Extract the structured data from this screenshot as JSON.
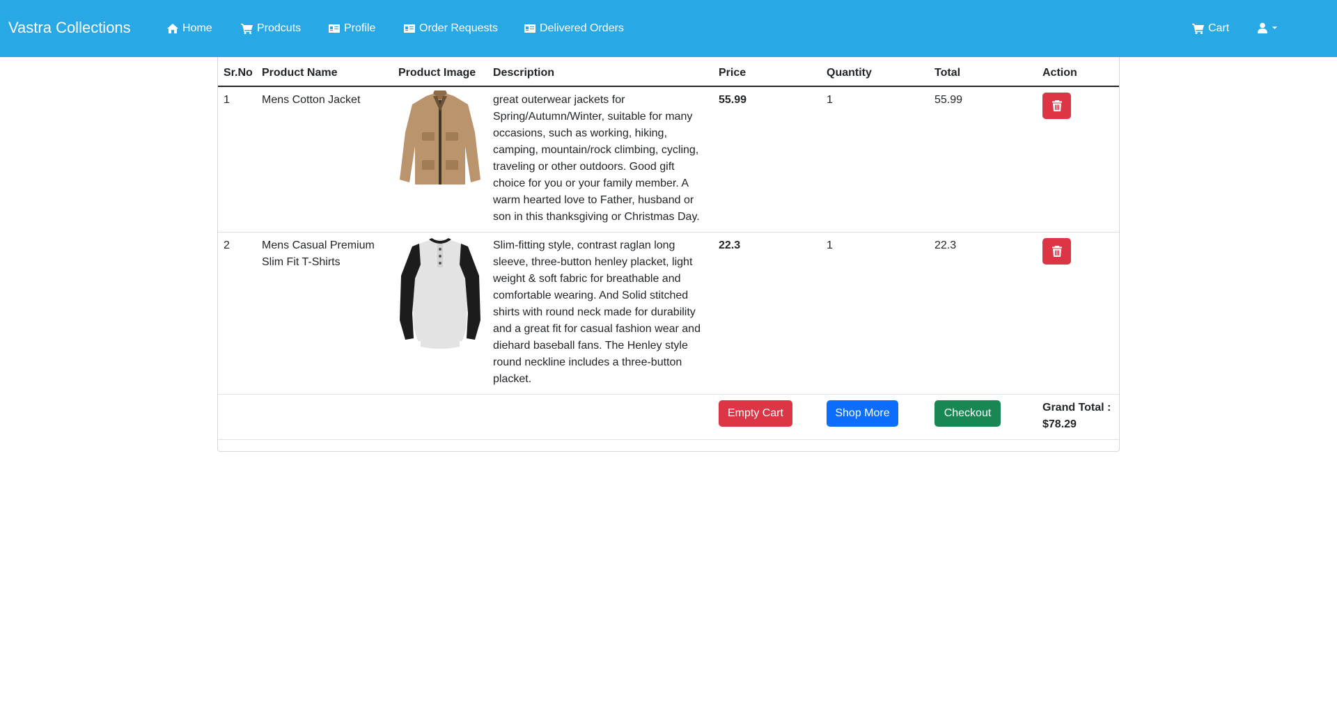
{
  "nav": {
    "brand": "Vastra Collections",
    "items": [
      {
        "label": "Home",
        "icon": "home-icon"
      },
      {
        "label": "Prodcuts",
        "icon": "cart-icon"
      },
      {
        "label": "Profile",
        "icon": "id-card-icon"
      },
      {
        "label": "Order Requests",
        "icon": "id-card-icon"
      },
      {
        "label": "Delivered Orders",
        "icon": "id-card-icon"
      }
    ],
    "cart_label": "Cart",
    "user_icon": "user-icon"
  },
  "table": {
    "headers": [
      "Sr.No",
      "Product Name",
      "Product Image",
      "Description",
      "Price",
      "Quantity",
      "Total",
      "Action"
    ],
    "rows": [
      {
        "srno": "1",
        "name": "Mens Cotton Jacket",
        "image": "jacket-image",
        "description": "great outerwear jackets for Spring/Autumn/Winter, suitable for many occasions, such as working, hiking, camping, mountain/rock climbing, cycling, traveling or other outdoors. Good gift choice for you or your family member. A warm hearted love to Father, husband or son in this thanksgiving or Christmas Day.",
        "price": "55.99",
        "quantity": "1",
        "total": "55.99"
      },
      {
        "srno": "2",
        "name": "Mens Casual Premium Slim Fit T-Shirts",
        "image": "tshirt-image",
        "description": "Slim-fitting style, contrast raglan long sleeve, three-button henley placket, light weight & soft fabric for breathable and comfortable wearing. And Solid stitched shirts with round neck made for durability and a great fit for casual fashion wear and diehard baseball fans. The Henley style round neckline includes a three-button placket.",
        "price": "22.3",
        "quantity": "1",
        "total": "22.3"
      }
    ]
  },
  "footer": {
    "empty_cart": "Empty Cart",
    "shop_more": "Shop More",
    "checkout": "Checkout",
    "grand_total_label": "Grand Total :",
    "grand_total_value": "$78.29"
  },
  "colors": {
    "navbar": "#29a8e6",
    "danger": "#dc3545",
    "primary": "#0d6efd",
    "success": "#198754"
  }
}
